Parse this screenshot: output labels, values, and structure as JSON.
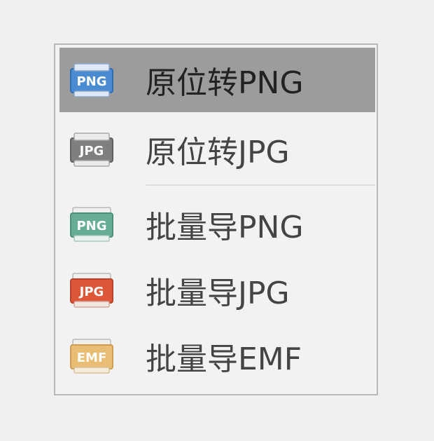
{
  "menu": {
    "items": [
      {
        "label": "原位转PNG",
        "icon": "png-blue-icon",
        "badge": "PNG",
        "color": "#3f7fc7",
        "selected": true
      },
      {
        "label": "原位转JPG",
        "icon": "jpg-gray-icon",
        "badge": "JPG",
        "color": "#7d7d7d",
        "selected": false
      },
      {
        "label": "批量导PNG",
        "icon": "png-green-icon",
        "badge": "PNG",
        "color": "#5fa78f",
        "selected": false
      },
      {
        "label": "批量导JPG",
        "icon": "jpg-red-icon",
        "badge": "JPG",
        "color": "#dd5638",
        "selected": false
      },
      {
        "label": "批量导EMF",
        "icon": "emf-yellow-icon",
        "badge": "EMF",
        "color": "#e8b96c",
        "selected": false
      }
    ]
  }
}
